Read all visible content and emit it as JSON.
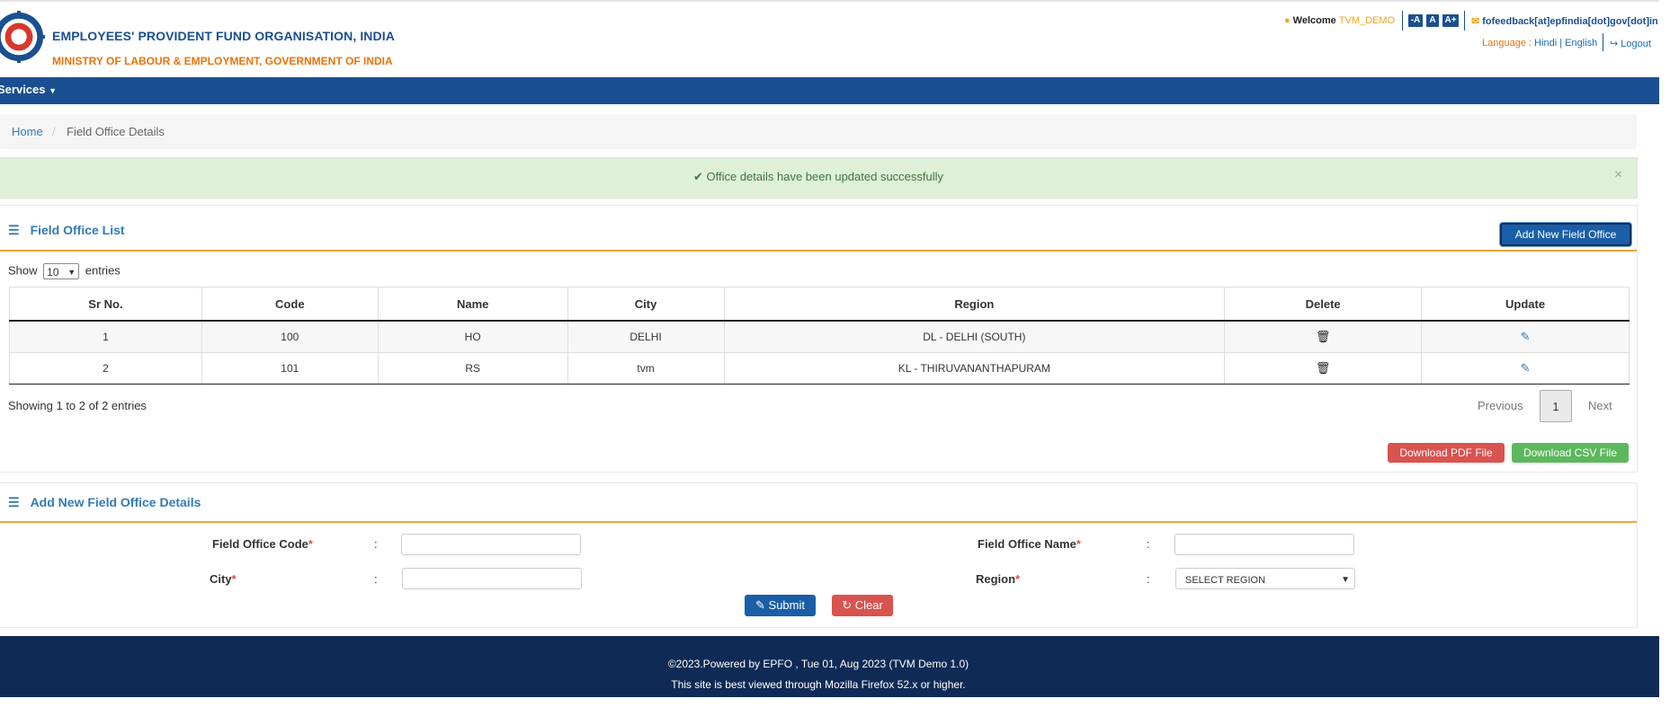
{
  "header": {
    "org_title": "EMPLOYEES' PROVIDENT FUND ORGANISATION, INDIA",
    "ministry": "MINISTRY OF LABOUR & EMPLOYMENT, GOVERNMENT OF INDIA",
    "welcome_label": "Welcome",
    "username": "TVM_DEMO",
    "font_buttons": [
      "-A",
      "A",
      "A+"
    ],
    "feedback_email": "fofeedback[at]epfindia[dot]gov[dot]in",
    "language_label": "Language :",
    "lang_hindi": "Hindi",
    "lang_sep": "|",
    "lang_english": "English",
    "logout": "Logout"
  },
  "nav": {
    "services": "Services"
  },
  "breadcrumb": {
    "home": "Home",
    "separator": "/",
    "current": "Field Office Details"
  },
  "alert": {
    "message": "Office details have been updated successfully",
    "close": "×"
  },
  "list_panel": {
    "title": "Field Office List",
    "add_button": "Add New Field Office",
    "show_label": "Show",
    "show_value": "10",
    "entries_label": "entries",
    "columns": [
      "Sr No.",
      "Code",
      "Name",
      "City",
      "Region",
      "Delete",
      "Update"
    ],
    "rows": [
      {
        "sr": "1",
        "code": "100",
        "name": "HO",
        "city": "DELHI",
        "region": "DL - DELHI (SOUTH)"
      },
      {
        "sr": "2",
        "code": "101",
        "name": "RS",
        "city": "tvm",
        "region": "KL - THIRUVANANTHAPURAM"
      }
    ],
    "showing_text": "Showing 1 to 2 of 2 entries",
    "pagination": {
      "previous": "Previous",
      "page": "1",
      "next": "Next"
    },
    "download_pdf": "Download PDF File",
    "download_csv": "Download CSV File"
  },
  "form_panel": {
    "title": "Add New Field Office Details",
    "field_office_code_label": "Field Office Code",
    "field_office_name_label": "Field Office Name",
    "city_label": "City",
    "region_label": "Region",
    "required_mark": "*",
    "colon": ":",
    "code_value": "",
    "name_value": "",
    "city_value": "",
    "region_selected": "SELECT REGION",
    "submit": "Submit",
    "clear": "Clear"
  },
  "footer": {
    "line1": "©2023.Powered by EPFO , Tue 01, Aug 2023 (TVM Demo 1.0)",
    "line2": "This site is best viewed through Mozilla Firefox 52.x or higher."
  },
  "colors": {
    "brand_blue": "#1a4f91",
    "accent_orange": "#e8740c",
    "footer_navy": "#0f2b55",
    "success_bg": "#dff0d8",
    "danger": "#d9534f",
    "success_btn": "#5cb85c"
  }
}
